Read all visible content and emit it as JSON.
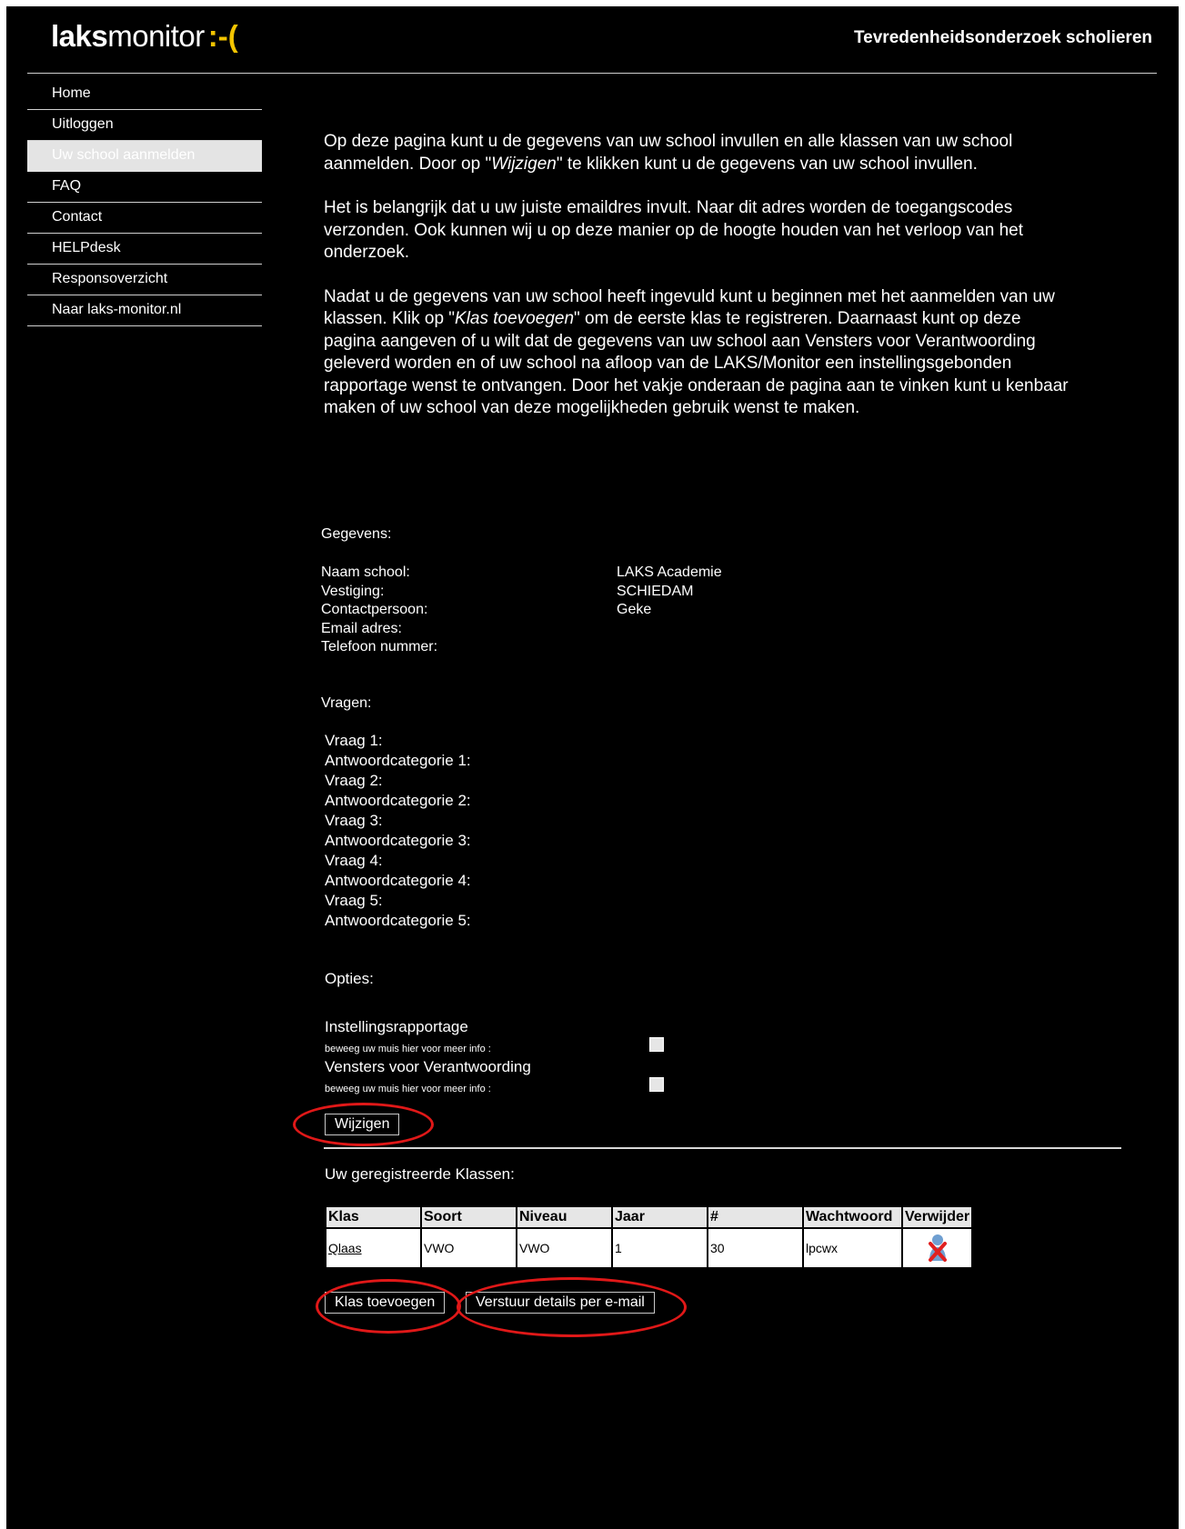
{
  "header": {
    "logo_bold": "laks",
    "logo_rest": "monitor",
    "logo_smiley": ":-(",
    "title": "Tevredenheidsonderzoek scholieren"
  },
  "nav": {
    "items": [
      {
        "label": "Home"
      },
      {
        "label": "Uitloggen"
      },
      {
        "label": "Uw school aanmelden",
        "active": true
      },
      {
        "label": "FAQ"
      },
      {
        "label": "Contact"
      },
      {
        "label": "HELPdesk"
      },
      {
        "label": "Responsoverzicht"
      },
      {
        "label": "Naar laks-monitor.nl"
      }
    ]
  },
  "intro": {
    "p1_a": "Op deze pagina kunt u de gegevens van uw school invullen en alle klassen van uw school aanmelden. Door op \"",
    "p1_em": "Wijzigen",
    "p1_b": "\" te klikken kunt u de gegevens van uw school invullen.",
    "p2": "Het is belangrijk dat u uw juiste emaildres invult. Naar dit adres worden de toegangscodes verzonden. Ook kunnen wij u op deze manier op de hoogte houden van het verloop van het onderzoek.",
    "p3_a": "Nadat u de gegevens van uw school heeft ingevuld kunt u beginnen met het aanmelden van uw klassen. Klik op \"",
    "p3_em": "Klas toevoegen",
    "p3_b": "\" om de eerste klas te registreren. Daarnaast kunt op deze pagina aangeven of u wilt dat de gegevens van uw school aan Vensters voor Verantwoording geleverd worden en of uw school na afloop van de LAKS/Monitor een instellingsgebonden rapportage wenst te ontvangen. Door het vakje onderaan de pagina aan te vinken kunt u kenbaar maken of uw school van deze mogelijkheden gebruik wenst te maken."
  },
  "gegevens": {
    "title": "Gegevens:",
    "naam_label": "Naam school:",
    "naam_value": "LAKS Academie",
    "vestiging_label": "Vestiging:",
    "vestiging_value": "SCHIEDAM",
    "contact_label": "Contactpersoon:",
    "contact_value": "Geke",
    "email_label": "Email adres:",
    "email_value": "",
    "telefoon_label": "Telefoon nummer:",
    "telefoon_value": ""
  },
  "vragen": {
    "title": "Vragen:",
    "lines": [
      "Vraag 1:",
      "Antwoordcategorie 1:",
      "Vraag 2:",
      "Antwoordcategorie 2:",
      "Vraag 3:",
      "Antwoordcategorie 3:",
      "Vraag 4:",
      "Antwoordcategorie 4:",
      "Vraag 5:",
      "Antwoordcategorie 5:"
    ]
  },
  "opties": {
    "title": "Opties:",
    "opt1_label": "Instellingsrapportage",
    "opt1_hint": "beweeg uw muis hier voor meer info :",
    "opt1_checked": false,
    "opt2_label": "Vensters voor Verantwoording",
    "opt2_hint": "beweeg uw muis hier voor meer info :",
    "opt2_checked": false
  },
  "buttons": {
    "wijzigen": "Wijzigen",
    "klas_toevoegen": "Klas toevoegen",
    "verstuur": "Verstuur details per e-mail"
  },
  "klassen": {
    "title": "Uw geregistreerde Klassen:",
    "headers": [
      "Klas",
      "Soort",
      "Niveau",
      "Jaar",
      "#",
      "Wachtwoord",
      "Verwijder"
    ],
    "rows": [
      {
        "klas": "Qlaas",
        "soort": "VWO",
        "niveau": "VWO",
        "jaar": "1",
        "aantal": "30",
        "wachtwoord": "lpcwx",
        "verwijder_icon": "delete-user-icon"
      }
    ]
  },
  "colors": {
    "background": "#000000",
    "accent": "#f3c400",
    "annotation": "#e01818"
  }
}
